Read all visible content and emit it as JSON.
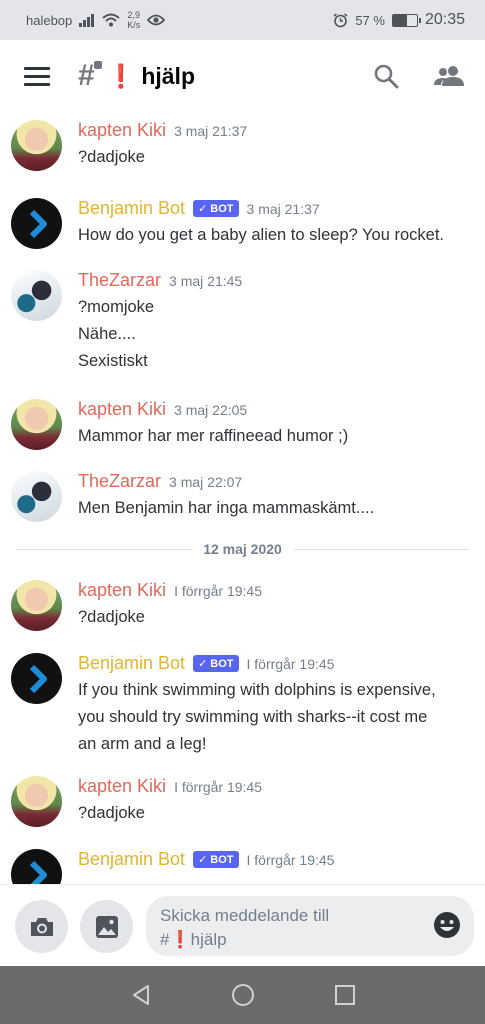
{
  "status_bar": {
    "carrier": "halebop",
    "net_speed_value": "2,9",
    "net_speed_unit": "K/s",
    "battery": "57 %",
    "battery_level": 0.57,
    "time": "20:35"
  },
  "header": {
    "channel_emoji": "❗",
    "channel_name": "hjälp"
  },
  "messages": [
    {
      "author": "kapten Kiki",
      "time": "3 maj 21:37",
      "lines": [
        "?dadjoke"
      ]
    },
    {
      "author": "Benjamin Bot",
      "bot_label": "BOT",
      "time": "3 maj 21:37",
      "lines": [
        "How do you get a baby alien to sleep?  You rocket."
      ]
    },
    {
      "author": "TheZarzar",
      "time": "3 maj 21:45",
      "lines": [
        "?momjoke",
        "Nähe....",
        "Sexistiskt"
      ]
    },
    {
      "author": "kapten Kiki",
      "time": "3 maj 22:05",
      "lines": [
        "Mammor har mer raffineead humor ;)"
      ]
    },
    {
      "author": "TheZarzar",
      "time": "3 maj 22:07",
      "lines": [
        "Men Benjamin har inga mammaskämt...."
      ]
    },
    {
      "author": "kapten Kiki",
      "time": "I förrgår 19:45",
      "lines": [
        "?dadjoke"
      ]
    },
    {
      "author": "Benjamin Bot",
      "bot_label": "BOT",
      "time": "I förrgår 19:45",
      "lines": [
        "If you think swimming with dolphins is expensive,",
        "you should try swimming with sharks--it cost me",
        "an arm and a leg!"
      ]
    },
    {
      "author": "kapten Kiki",
      "time": "I förrgår 19:45",
      "lines": [
        "?dadjoke"
      ]
    },
    {
      "author": "Benjamin Bot",
      "bot_label": "BOT",
      "time": "I förrgår 19:45",
      "lines": []
    }
  ],
  "date_divider": "12 maj 2020",
  "composer": {
    "placeholder_line1": "Skicka meddelande till",
    "placeholder_hash": "#",
    "placeholder_emoji": "❗",
    "placeholder_channel": "hjälp"
  },
  "icons": {
    "camera": "camera-icon",
    "gallery": "image-icon",
    "emoji": "emoji-icon",
    "search": "search-icon",
    "members": "members-icon",
    "back": "back-icon",
    "home": "home-icon",
    "recents": "recents-icon"
  },
  "colors": {
    "author_red": "#e3685a",
    "author_bot": "#e2b52a",
    "bot_badge": "#5865f2",
    "channel_emoji": "#dd2e44"
  }
}
